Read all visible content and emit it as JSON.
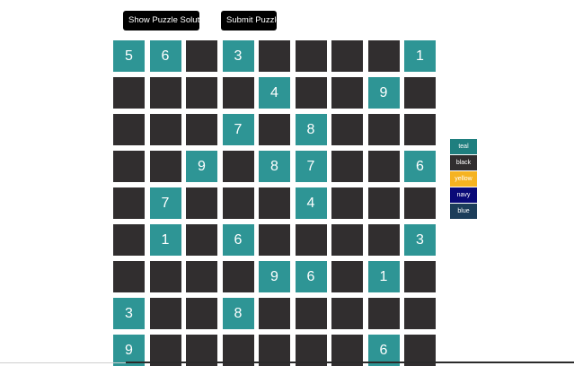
{
  "toolbar": {
    "show_solution_label": "Show Puzzle Solution",
    "submit_label": "Submit Puzzle"
  },
  "colors": {
    "black_cell": "#312e2f",
    "teal_cell": "#2e9595",
    "button_bg": "#000000"
  },
  "grid": {
    "rows": [
      [
        {
          "v": "5",
          "c": "teal"
        },
        {
          "v": "6",
          "c": "teal"
        },
        {
          "v": "",
          "c": "black"
        },
        {
          "v": "3",
          "c": "teal"
        },
        {
          "v": "",
          "c": "black"
        },
        {
          "v": "",
          "c": "black"
        },
        {
          "v": "",
          "c": "black"
        },
        {
          "v": "",
          "c": "black"
        },
        {
          "v": "1",
          "c": "teal"
        }
      ],
      [
        {
          "v": "",
          "c": "black"
        },
        {
          "v": "",
          "c": "black"
        },
        {
          "v": "",
          "c": "black"
        },
        {
          "v": "",
          "c": "black"
        },
        {
          "v": "4",
          "c": "teal"
        },
        {
          "v": "",
          "c": "black"
        },
        {
          "v": "",
          "c": "black"
        },
        {
          "v": "9",
          "c": "teal"
        },
        {
          "v": "",
          "c": "black"
        }
      ],
      [
        {
          "v": "",
          "c": "black"
        },
        {
          "v": "",
          "c": "black"
        },
        {
          "v": "",
          "c": "black"
        },
        {
          "v": "7",
          "c": "teal"
        },
        {
          "v": "",
          "c": "black"
        },
        {
          "v": "8",
          "c": "teal"
        },
        {
          "v": "",
          "c": "black"
        },
        {
          "v": "",
          "c": "black"
        },
        {
          "v": "",
          "c": "black"
        }
      ],
      [
        {
          "v": "",
          "c": "black"
        },
        {
          "v": "",
          "c": "black"
        },
        {
          "v": "9",
          "c": "teal"
        },
        {
          "v": "",
          "c": "black"
        },
        {
          "v": "8",
          "c": "teal"
        },
        {
          "v": "7",
          "c": "teal"
        },
        {
          "v": "",
          "c": "black"
        },
        {
          "v": "",
          "c": "black"
        },
        {
          "v": "6",
          "c": "teal"
        }
      ],
      [
        {
          "v": "",
          "c": "black"
        },
        {
          "v": "7",
          "c": "teal"
        },
        {
          "v": "",
          "c": "black"
        },
        {
          "v": "",
          "c": "black"
        },
        {
          "v": "",
          "c": "black"
        },
        {
          "v": "4",
          "c": "teal"
        },
        {
          "v": "",
          "c": "black"
        },
        {
          "v": "",
          "c": "black"
        },
        {
          "v": "",
          "c": "black"
        }
      ],
      [
        {
          "v": "",
          "c": "black"
        },
        {
          "v": "1",
          "c": "teal"
        },
        {
          "v": "",
          "c": "black"
        },
        {
          "v": "6",
          "c": "teal"
        },
        {
          "v": "",
          "c": "black"
        },
        {
          "v": "",
          "c": "black"
        },
        {
          "v": "",
          "c": "black"
        },
        {
          "v": "",
          "c": "black"
        },
        {
          "v": "3",
          "c": "teal"
        }
      ],
      [
        {
          "v": "",
          "c": "black"
        },
        {
          "v": "",
          "c": "black"
        },
        {
          "v": "",
          "c": "black"
        },
        {
          "v": "",
          "c": "black"
        },
        {
          "v": "9",
          "c": "teal"
        },
        {
          "v": "6",
          "c": "teal"
        },
        {
          "v": "",
          "c": "black"
        },
        {
          "v": "1",
          "c": "teal"
        },
        {
          "v": "",
          "c": "black"
        }
      ],
      [
        {
          "v": "3",
          "c": "teal"
        },
        {
          "v": "",
          "c": "black"
        },
        {
          "v": "",
          "c": "black"
        },
        {
          "v": "8",
          "c": "teal"
        },
        {
          "v": "",
          "c": "black"
        },
        {
          "v": "",
          "c": "black"
        },
        {
          "v": "",
          "c": "black"
        },
        {
          "v": "",
          "c": "black"
        },
        {
          "v": "",
          "c": "black"
        }
      ],
      [
        {
          "v": "9",
          "c": "teal"
        },
        {
          "v": "",
          "c": "black"
        },
        {
          "v": "",
          "c": "black"
        },
        {
          "v": "",
          "c": "black"
        },
        {
          "v": "",
          "c": "black"
        },
        {
          "v": "",
          "c": "black"
        },
        {
          "v": "",
          "c": "black"
        },
        {
          "v": "6",
          "c": "teal"
        },
        {
          "v": "",
          "c": "black"
        }
      ]
    ]
  },
  "palette": {
    "items": [
      {
        "label": "teal",
        "color": "#1f7f7f"
      },
      {
        "label": "black",
        "color": "#312e2f"
      },
      {
        "label": "yellow",
        "color": "#f5b321"
      },
      {
        "label": "navy",
        "color": "#0a0a78"
      },
      {
        "label": "blue",
        "color": "#1c3d5a"
      }
    ]
  }
}
